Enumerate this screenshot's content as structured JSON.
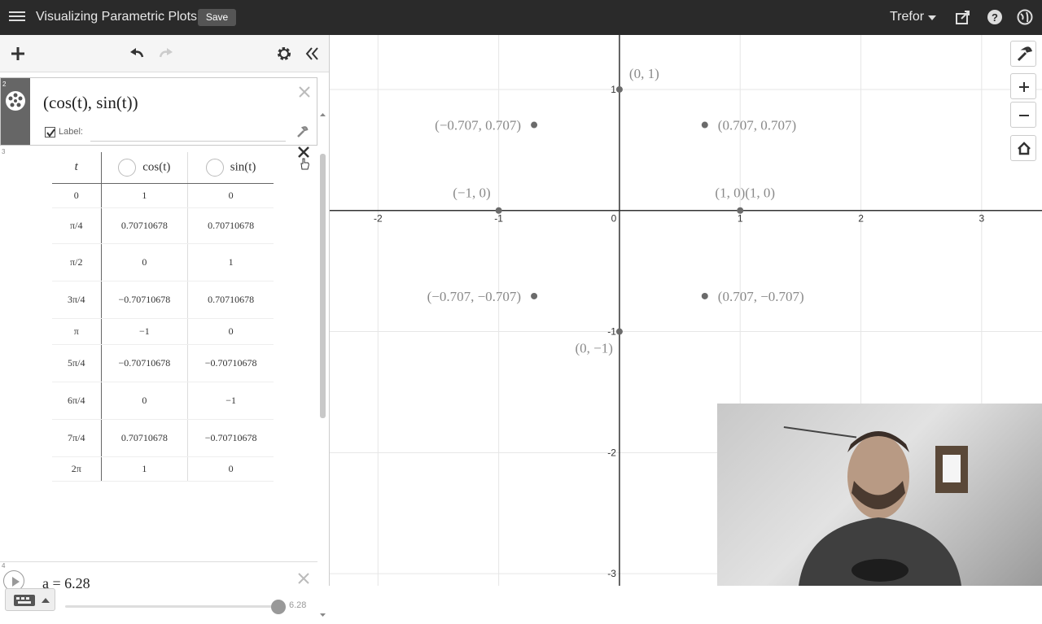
{
  "topbar": {
    "title": "Visualizing Parametric Plots",
    "save_label": "Save",
    "user": "Trefor"
  },
  "expressions": {
    "expr2": {
      "index": "2",
      "latex_text": "(cos(t), sin(t))",
      "label_text": "Label:"
    },
    "expr3": {
      "index": "3",
      "headers": [
        "t",
        "cos(t)",
        "sin(t)"
      ],
      "rows": [
        [
          "0",
          "1",
          "0"
        ],
        [
          "π/4",
          "0.70710678",
          "0.70710678"
        ],
        [
          "π/2",
          "0",
          "1"
        ],
        [
          "3π/4",
          "−0.70710678",
          "0.70710678"
        ],
        [
          "π",
          "−1",
          "0"
        ],
        [
          "5π/4",
          "−0.70710678",
          "−0.70710678"
        ],
        [
          "6π/4",
          "0",
          "−1"
        ],
        [
          "7π/4",
          "0.70710678",
          "−0.70710678"
        ],
        [
          "2π",
          "1",
          "0"
        ]
      ]
    },
    "expr4": {
      "index": "4",
      "text": "a = 6.28",
      "slider_value": "6.28",
      "slider_fraction": 1.0
    }
  },
  "graph": {
    "x_ticks": [
      "-2",
      "-1",
      "0",
      "1",
      "2",
      "3"
    ],
    "y_ticks": [
      "1",
      "-1",
      "-2",
      "-3"
    ],
    "xlim": [
      -2.4,
      3.5
    ],
    "ylim": [
      -3.1,
      1.45
    ],
    "points": [
      {
        "x": 1,
        "y": 0,
        "label": "(1, 0)"
      },
      {
        "x": 0.707,
        "y": 0.707,
        "label": "(0.707, 0.707)"
      },
      {
        "x": 0,
        "y": 1,
        "label": "(0, 1)"
      },
      {
        "x": -0.707,
        "y": 0.707,
        "label": "(−0.707, 0.707)"
      },
      {
        "x": -1,
        "y": 0,
        "label": "(−1, 0)"
      },
      {
        "x": -0.707,
        "y": -0.707,
        "label": "(−0.707, −0.707)"
      },
      {
        "x": 0,
        "y": -1,
        "label": "(0, −1)"
      },
      {
        "x": 0.707,
        "y": -0.707,
        "label": "(0.707, −0.707)"
      }
    ],
    "extra_label": "(1, 0)",
    "colors": {
      "point": "#6b6b6b",
      "label": "#8a8a8a",
      "grid": "#e6e6e6",
      "axis": "#333333"
    }
  }
}
